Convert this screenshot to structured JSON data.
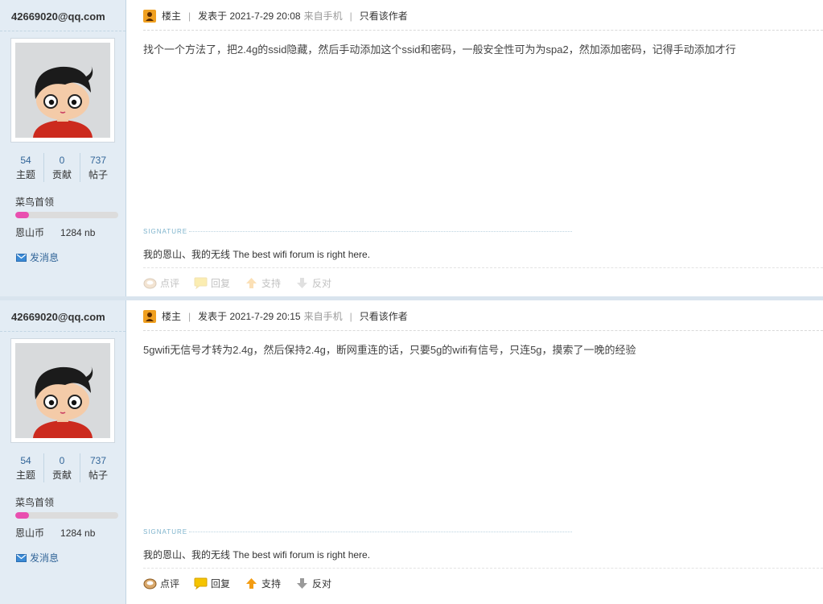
{
  "posts": [
    {
      "author": {
        "name": "42669020@qq.com",
        "stats": [
          {
            "value": "54",
            "label": "主题"
          },
          {
            "value": "0",
            "label": "贡献"
          },
          {
            "value": "737",
            "label": "帖子"
          }
        ],
        "rank": "菜鸟首领",
        "rank_progress": 0.13,
        "coin_label": "恩山币",
        "coin_value": "1284 nb",
        "pm_label": "发消息"
      },
      "header": {
        "role": "楼主",
        "posted": "发表于 2021-7-29 20:08",
        "via": "来自手机",
        "author_only": "只看该作者"
      },
      "content": "找个一个方法了，把2.4g的ssid隐藏，然后手动添加这个ssid和密码，一般安全性可为为spa2，然加添加密码，记得手动添加才行",
      "signature_label": "SIGNATURE",
      "signature": "我的恩山、我的无线 The best wifi forum is right here.",
      "actions": {
        "comment": "点评",
        "reply": "回复",
        "support": "支持",
        "oppose": "反对"
      }
    },
    {
      "author": {
        "name": "42669020@qq.com",
        "stats": [
          {
            "value": "54",
            "label": "主题"
          },
          {
            "value": "0",
            "label": "贡献"
          },
          {
            "value": "737",
            "label": "帖子"
          }
        ],
        "rank": "菜鸟首领",
        "rank_progress": 0.13,
        "coin_label": "恩山币",
        "coin_value": "1284 nb",
        "pm_label": "发消息"
      },
      "header": {
        "role": "楼主",
        "posted": "发表于 2021-7-29 20:15",
        "via": "来自手机",
        "author_only": "只看该作者"
      },
      "content": "5gwifi无信号才转为2.4g，然后保持2.4g，断网重连的话，只要5g的wifi有信号，只连5g，摸索了一晚的经验",
      "signature_label": "SIGNATURE",
      "signature": "我的恩山、我的无线 The best wifi forum is right here.",
      "actions": {
        "comment": "点评",
        "reply": "回复",
        "support": "支持",
        "oppose": "反对"
      }
    }
  ],
  "icons": {
    "floor": "floor-owner-icon",
    "pm": "envelope-icon",
    "comment": "comment-icon",
    "reply": "reply-icon",
    "support": "thumbs-up-arrow-icon",
    "oppose": "thumbs-down-arrow-icon"
  },
  "colors": {
    "sidebar_bg": "#e3ecf4",
    "link": "#336699",
    "rank_bar": "#e94fb0",
    "signature_label": "#7db3cc"
  }
}
